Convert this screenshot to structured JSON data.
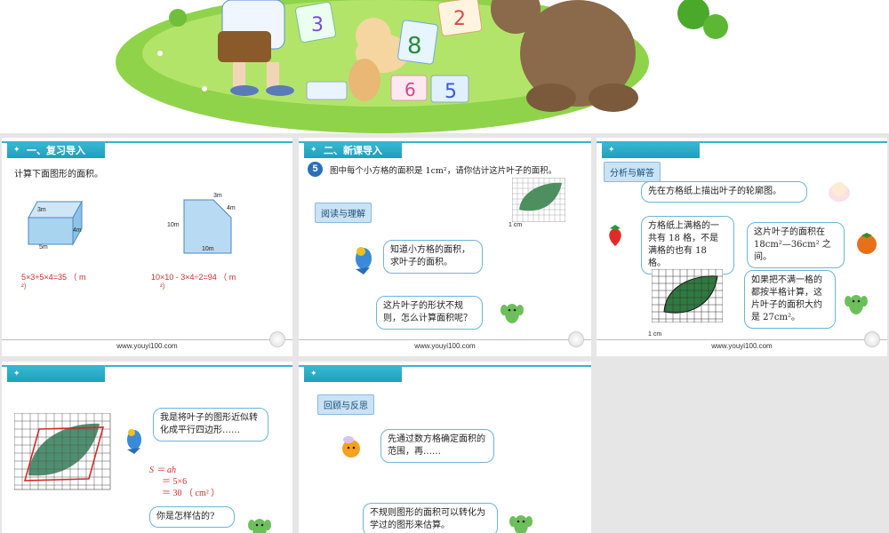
{
  "slide1": {
    "tag": "一、复习导入",
    "instruction": "计算下面图形的面积。",
    "dims": {
      "a": "3m",
      "b": "4m",
      "c": "5m",
      "d": "3m",
      "e": "4m",
      "f": "10m",
      "g": "10m"
    },
    "formula1": "5×3+5×4=35 （ m",
    "formula1b": "²）",
    "formula2": "10×10 - 3×4÷2=94 （ m",
    "formula2b": "²）",
    "url": "www.youyi100.com"
  },
  "slide2": {
    "tag": "二、新课导入",
    "number": "5",
    "question": "图中每个小方格的面积是 1cm²，请你估计这片叶子的面积。",
    "grid_label": "1 cm",
    "read_label": "阅读与理解",
    "bubble1": "知道小方格的面积，求叶子的面积。",
    "bubble2": "这片叶子的形状不规则，怎么计算面积呢？",
    "url": "www.youyi100.com"
  },
  "slide3": {
    "label": "分析与解答",
    "bubble1": "先在方格纸上描出叶子的轮廓图。",
    "bubble2": "方格纸上满格的一共有 18 格，不是满格的也有 18 格。",
    "bubble3": "这片叶子的面积在 18cm²—36cm² 之间。",
    "bubble4": "如果把不满一格的都按半格计算，这片叶子的面积大约是 27cm²。",
    "grid_label": "1 cm",
    "url": "www.youyi100.com"
  },
  "slide4": {
    "bubble1": "我是将叶子的图形近似转化成平行四边形……",
    "f1": "S ＝ ah",
    "f2": "＝ 5×6",
    "f3": "＝ 30 （ cm² ）",
    "bubble2": "你是怎样估的?"
  },
  "slide5": {
    "label": "回顾与反思",
    "bubble1": "先通过数方格确定面积的范围，再……",
    "bubble2": "不规则图形的面积可以转化为学过的图形来估算。"
  },
  "colors": {
    "accent": "#39b4cc",
    "red": "#d02a2a",
    "leaf": "#4e8f5f"
  }
}
